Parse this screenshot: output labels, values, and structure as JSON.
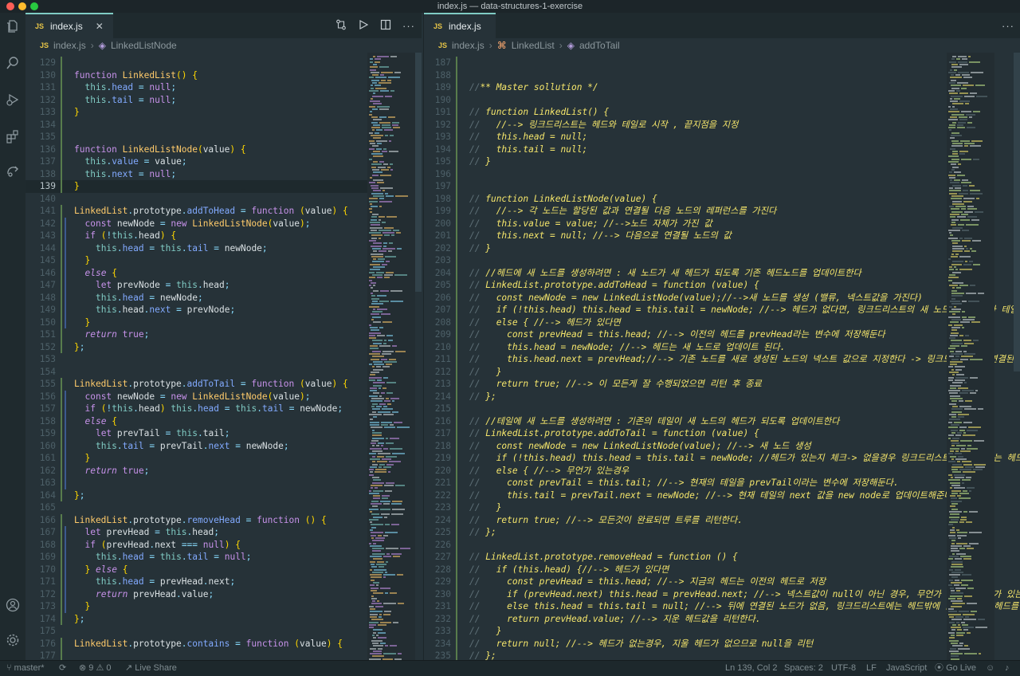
{
  "window": {
    "title": "index.js — data-structures-1-exercise",
    "traffic_lights": [
      "close",
      "minimize",
      "maximize"
    ]
  },
  "activity_bar": [
    {
      "name": "explorer-icon",
      "glyph": "▭"
    },
    {
      "name": "search-icon",
      "glyph": "⌕"
    },
    {
      "name": "run-debug-icon",
      "glyph": "▷"
    },
    {
      "name": "extensions-icon",
      "glyph": "▦"
    },
    {
      "name": "remote-icon",
      "glyph": "⟲"
    },
    {
      "name": "account-icon",
      "glyph": "◯"
    },
    {
      "name": "settings-icon",
      "glyph": "⚙"
    }
  ],
  "left_editor": {
    "tab": {
      "label": "index.js",
      "badge": "JS"
    },
    "tab_actions": [
      "compare-icon",
      "run-icon",
      "split-editor-icon",
      "more-icon"
    ],
    "breadcrumb": [
      {
        "label": "index.js",
        "badge": "JS"
      },
      {
        "label": "LinkedListNode"
      }
    ],
    "lines": [
      {
        "num": "129",
        "text": ""
      },
      {
        "num": "130",
        "text": "function LinkedList() {"
      },
      {
        "num": "131",
        "text": "  this.head = null;"
      },
      {
        "num": "132",
        "text": "  this.tail = null;"
      },
      {
        "num": "133",
        "text": "}"
      },
      {
        "num": "134",
        "text": ""
      },
      {
        "num": "135",
        "text": ""
      },
      {
        "num": "136",
        "text": "function LinkedListNode(value) {"
      },
      {
        "num": "137",
        "text": "  this.value = value;"
      },
      {
        "num": "138",
        "text": "  this.next = null;"
      },
      {
        "num": "139",
        "text": "}"
      },
      {
        "num": "140",
        "text": ""
      },
      {
        "num": "141",
        "text": "LinkedList.prototype.addToHead = function (value) {"
      },
      {
        "num": "142",
        "text": "  const newNode = new LinkedListNode(value);"
      },
      {
        "num": "143",
        "text": "  if (!this.head) {"
      },
      {
        "num": "144",
        "text": "    this.head = this.tail = newNode;"
      },
      {
        "num": "145",
        "text": "  }"
      },
      {
        "num": "146",
        "text": "  else {"
      },
      {
        "num": "147",
        "text": "    let prevNode = this.head;"
      },
      {
        "num": "148",
        "text": "    this.head = newNode;"
      },
      {
        "num": "149",
        "text": "    this.head.next = prevNode;"
      },
      {
        "num": "150",
        "text": "  }"
      },
      {
        "num": "151",
        "text": "  return true;"
      },
      {
        "num": "152",
        "text": "};"
      },
      {
        "num": "153",
        "text": ""
      },
      {
        "num": "154",
        "text": ""
      },
      {
        "num": "155",
        "text": "LinkedList.prototype.addToTail = function (value) {"
      },
      {
        "num": "156",
        "text": "  const newNode = new LinkedListNode(value);"
      },
      {
        "num": "157",
        "text": "  if (!this.head) this.head = this.tail = newNode;"
      },
      {
        "num": "158",
        "text": "  else {"
      },
      {
        "num": "159",
        "text": "    let prevTail = this.tail;"
      },
      {
        "num": "160",
        "text": "    this.tail = prevTail.next = newNode;"
      },
      {
        "num": "161",
        "text": "  }"
      },
      {
        "num": "162",
        "text": "  return true;"
      },
      {
        "num": "163",
        "text": ""
      },
      {
        "num": "164",
        "text": "};"
      },
      {
        "num": "165",
        "text": ""
      },
      {
        "num": "166",
        "text": "LinkedList.prototype.removeHead = function () {"
      },
      {
        "num": "167",
        "text": "  let prevHead = this.head;"
      },
      {
        "num": "168",
        "text": "  if (prevHead.next === null) {"
      },
      {
        "num": "169",
        "text": "    this.head = this.tail = null;"
      },
      {
        "num": "170",
        "text": "  } else {"
      },
      {
        "num": "171",
        "text": "    this.head = prevHead.next;"
      },
      {
        "num": "172",
        "text": "    return prevHead.value;"
      },
      {
        "num": "173",
        "text": "  }"
      },
      {
        "num": "174",
        "text": "};"
      },
      {
        "num": "175",
        "text": ""
      },
      {
        "num": "176",
        "text": "LinkedList.prototype.contains = function (value) {"
      },
      {
        "num": "177",
        "text": ""
      }
    ]
  },
  "right_editor": {
    "tab": {
      "label": "index.js",
      "badge": "JS"
    },
    "tab_actions": [
      "more-icon"
    ],
    "breadcrumb": [
      {
        "label": "index.js",
        "badge": "JS"
      },
      {
        "label": "LinkedList"
      },
      {
        "label": "addToTail"
      }
    ],
    "lines": [
      {
        "num": "187",
        "text": ""
      },
      {
        "num": "188",
        "text": ""
      },
      {
        "num": "189",
        "text": "//** Master sollution */"
      },
      {
        "num": "190",
        "text": ""
      },
      {
        "num": "191",
        "text": "// function LinkedList() {"
      },
      {
        "num": "192",
        "text": "//   //--> 링크드리스트는 헤드와 테일로 시작 , 끝지점을 지정"
      },
      {
        "num": "193",
        "text": "//   this.head = null;"
      },
      {
        "num": "194",
        "text": "//   this.tail = null;"
      },
      {
        "num": "195",
        "text": "// }"
      },
      {
        "num": "196",
        "text": ""
      },
      {
        "num": "197",
        "text": ""
      },
      {
        "num": "198",
        "text": "// function LinkedListNode(value) {"
      },
      {
        "num": "199",
        "text": "//   //--> 각 노드는 할당된 값과 연결될 다음 노드의 레퍼런스를 가진다"
      },
      {
        "num": "200",
        "text": "//   this.value = value; //-->노드 자체가 가진 값"
      },
      {
        "num": "201",
        "text": "//   this.next = null; //--> 다음으로 연결될 노드의 값"
      },
      {
        "num": "202",
        "text": "// }"
      },
      {
        "num": "203",
        "text": ""
      },
      {
        "num": "204",
        "text": "// //헤드에 새 노드를 생성하려면 : 새 노드가 새 헤드가 되도록 기존 헤드노드를 업데이트한다"
      },
      {
        "num": "205",
        "text": "// LinkedList.prototype.addToHead = function (value) {"
      },
      {
        "num": "206",
        "text": "//   const newNode = new LinkedListNode(value);//-->새 노드를 생성 (밸류, 넥스트값을 가진다)"
      },
      {
        "num": "207",
        "text": "//   if (!this.head) this.head = this.tail = newNode; //--> 헤드가 없다면, 링크드리스트의 새 노드는 헤드이자 테일"
      },
      {
        "num": "208",
        "text": "//   else { //--> 헤드가 있다면"
      },
      {
        "num": "209",
        "text": "//     const prevHead = this.head; //--> 이전의 헤드를 prevHead라는 변수에 저장해둔다"
      },
      {
        "num": "210",
        "text": "//     this.head = newNode; //--> 헤드는 새 노드로 업데이트 된다."
      },
      {
        "num": "211",
        "text": "//     this.head.next = prevHead;//--> 기존 노드를 새로 생성된 노드의 넥스트 값으로 지정한다 -> 링크드리스트가 연결된다"
      },
      {
        "num": "212",
        "text": "//   }"
      },
      {
        "num": "213",
        "text": "//   return true; //--> 이 모든게 잘 수행되었으면 리턴 후 종료"
      },
      {
        "num": "214",
        "text": "// };"
      },
      {
        "num": "215",
        "text": ""
      },
      {
        "num": "216",
        "text": "// //테일에 새 노드를 생성하려면 : 기존의 테일이 새 노드의 헤드가 되도록 업데이트한다"
      },
      {
        "num": "217",
        "text": "// LinkedList.prototype.addToTail = function (value) {"
      },
      {
        "num": "218",
        "text": "//   const newNode = new LinkedListNode(value); //--> 새 노드 생성"
      },
      {
        "num": "219",
        "text": "//   if (!this.head) this.head = this.tail = newNode; //헤드가 있는지 체크-> 없을경우 링크드리스트의 새 노드는 헤드이자 테일"
      },
      {
        "num": "220",
        "text": "//   else { //--> 무언가 있는경우"
      },
      {
        "num": "221",
        "text": "//     const prevTail = this.tail; //--> 현재의 테일을 prevTail이라는 변수에 저장해둔다."
      },
      {
        "num": "222",
        "text": "//     this.tail = prevTail.next = newNode; //--> 현재 테일의 next 값을 new node로 업데이트해준다."
      },
      {
        "num": "223",
        "text": "//   }"
      },
      {
        "num": "224",
        "text": "//   return true; //--> 모든것이 완료되면 트루를 리턴한다."
      },
      {
        "num": "225",
        "text": "// };"
      },
      {
        "num": "226",
        "text": ""
      },
      {
        "num": "227",
        "text": "// LinkedList.prototype.removeHead = function () {"
      },
      {
        "num": "228",
        "text": "//   if (this.head) {//--> 헤드가 있다면"
      },
      {
        "num": "229",
        "text": "//     const prevHead = this.head; //--> 지금의 헤드는 이전의 헤드로 저장"
      },
      {
        "num": "230",
        "text": "//     if (prevHead.next) this.head = prevHead.next; //--> 넥스트값이 null이 아닌 경우, 무언가 연결된 노드가 있는 경우"
      },
      {
        "num": "231",
        "text": "//     else this.head = this.tail = null; //--> 뒤에 연결된 노드가 없음, 링크드리스트에는 헤드밖에 없는 경우, 헤드를 삭제"
      },
      {
        "num": "232",
        "text": "//     return prevHead.value; //--> 지운 헤드값을 리턴한다."
      },
      {
        "num": "233",
        "text": "//   }"
      },
      {
        "num": "234",
        "text": "//   return null; //--> 헤드가 없는경우, 지울 헤드가 없으므로 null을 리턴"
      },
      {
        "num": "235",
        "text": "// };"
      }
    ]
  },
  "status_bar": {
    "branch": "master*",
    "sync_icon": "sync-icon",
    "errors": "9",
    "warnings": "0",
    "live_share": "Live Share",
    "position": "Ln 139, Col 2",
    "spaces": "Spaces: 2",
    "encoding": "UTF-8",
    "eol": "LF",
    "language": "JavaScript",
    "go_live": "Go Live",
    "feedback_icon": "feedback-icon",
    "bell_icon": "bell-icon"
  },
  "colors": {
    "editor_bg": "#263238",
    "keyword": "#c792ea",
    "function": "#ffcb6b",
    "this": "#80cbc4",
    "string": "#c3e88d",
    "comment_yellow": "#f5e66b",
    "line_number": "#4d6068",
    "accent": "#80cbc4"
  }
}
